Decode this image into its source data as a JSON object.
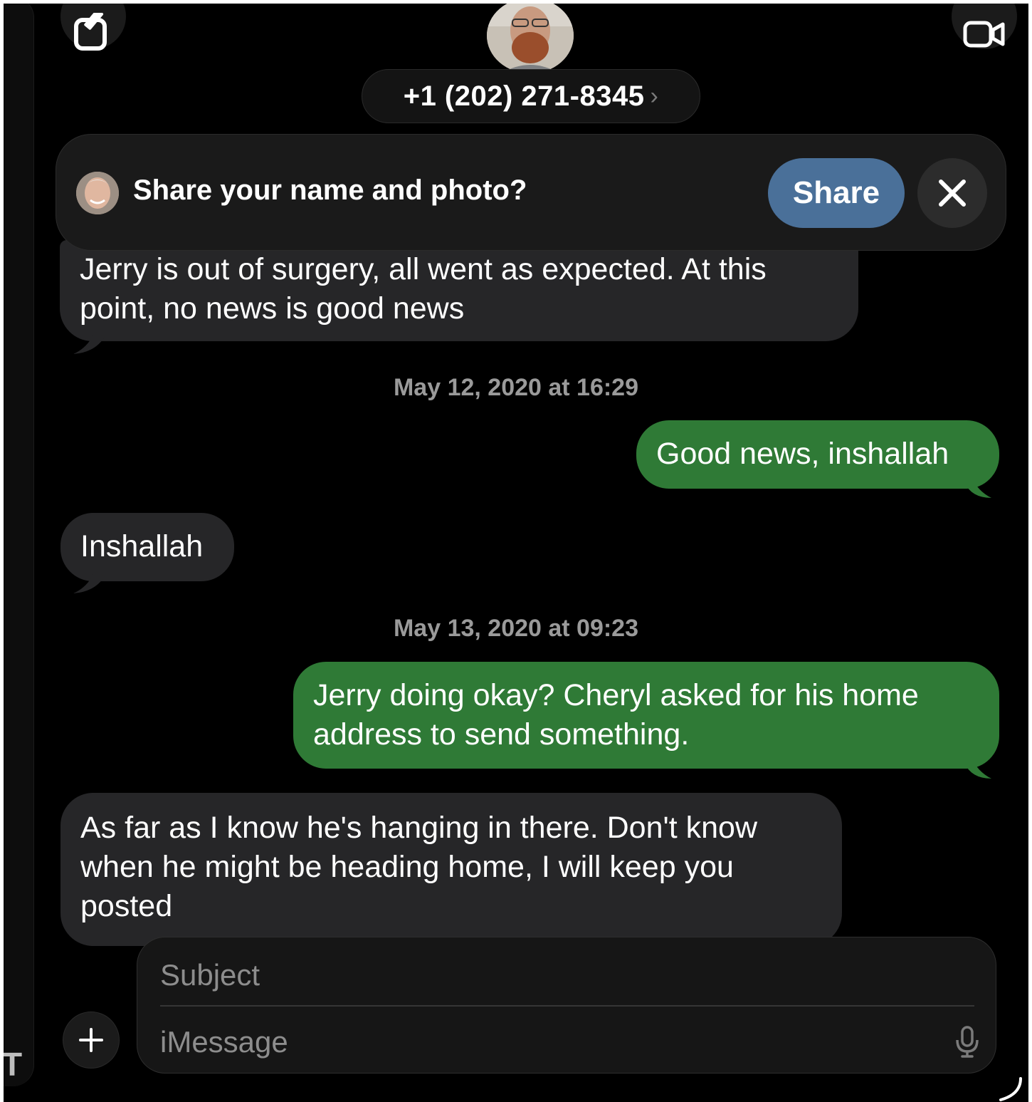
{
  "header": {
    "contact_label": "+1 (202) 271-8345",
    "contact_chevron": "›",
    "compose_icon": "compose-icon",
    "video_icon": "video-camera-icon"
  },
  "share_banner": {
    "question": "Share your name and photo?",
    "share_label": "Share",
    "dismiss_icon": "close-icon",
    "share_color": "#4a7099"
  },
  "conversation": {
    "messages": [
      {
        "direction": "incoming",
        "text": "Jerry is out of surgery, all went as expected. At this point, no news is good news"
      },
      {
        "direction": "outgoing",
        "text": "Good news, inshallah"
      },
      {
        "direction": "incoming",
        "text": "Inshallah"
      },
      {
        "direction": "outgoing",
        "text": "Jerry doing okay? Cheryl asked for his home address to send something."
      },
      {
        "direction": "incoming",
        "text": "As far as I know he's hanging in there. Don't know when he might be heading home, I will keep you posted"
      }
    ],
    "timestamps": [
      "May 12, 2020 at 16:29",
      "May 13, 2020 at 09:23"
    ],
    "incoming_color": "#262628",
    "outgoing_color": "#2f7a36"
  },
  "composer": {
    "subject_placeholder": "Subject",
    "message_placeholder": "iMessage",
    "plus_icon": "plus-icon",
    "mic_icon": "microphone-icon"
  }
}
